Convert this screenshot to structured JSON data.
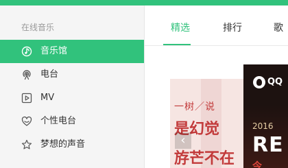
{
  "sidebar": {
    "section_title": "在线音乐",
    "items": [
      {
        "label": "音乐馆",
        "icon": "music-note-icon",
        "active": true
      },
      {
        "label": "电台",
        "icon": "radio-icon",
        "active": false
      },
      {
        "label": "MV",
        "icon": "mv-play-icon",
        "active": false
      },
      {
        "label": "个性电台",
        "icon": "heart-icon",
        "active": false
      },
      {
        "label": "梦想的声音",
        "icon": "star-icon",
        "active": false
      }
    ]
  },
  "main": {
    "tabs": [
      {
        "label": "精选",
        "active": true
      },
      {
        "label": "排行",
        "active": false
      },
      {
        "label": "歌",
        "active": false
      }
    ],
    "banner_left": {
      "line1": "一树／说",
      "line2": "是幻觉",
      "line3": "斿芒不在"
    },
    "banner_right": {
      "logo_text": "QQ",
      "year_text": "2016",
      "big_text": "RE",
      "bottom_text": "今"
    }
  },
  "colors": {
    "accent": "#31c27c",
    "sidebar_bg": "#f5f5f5",
    "text": "#333333",
    "muted": "#999999"
  }
}
